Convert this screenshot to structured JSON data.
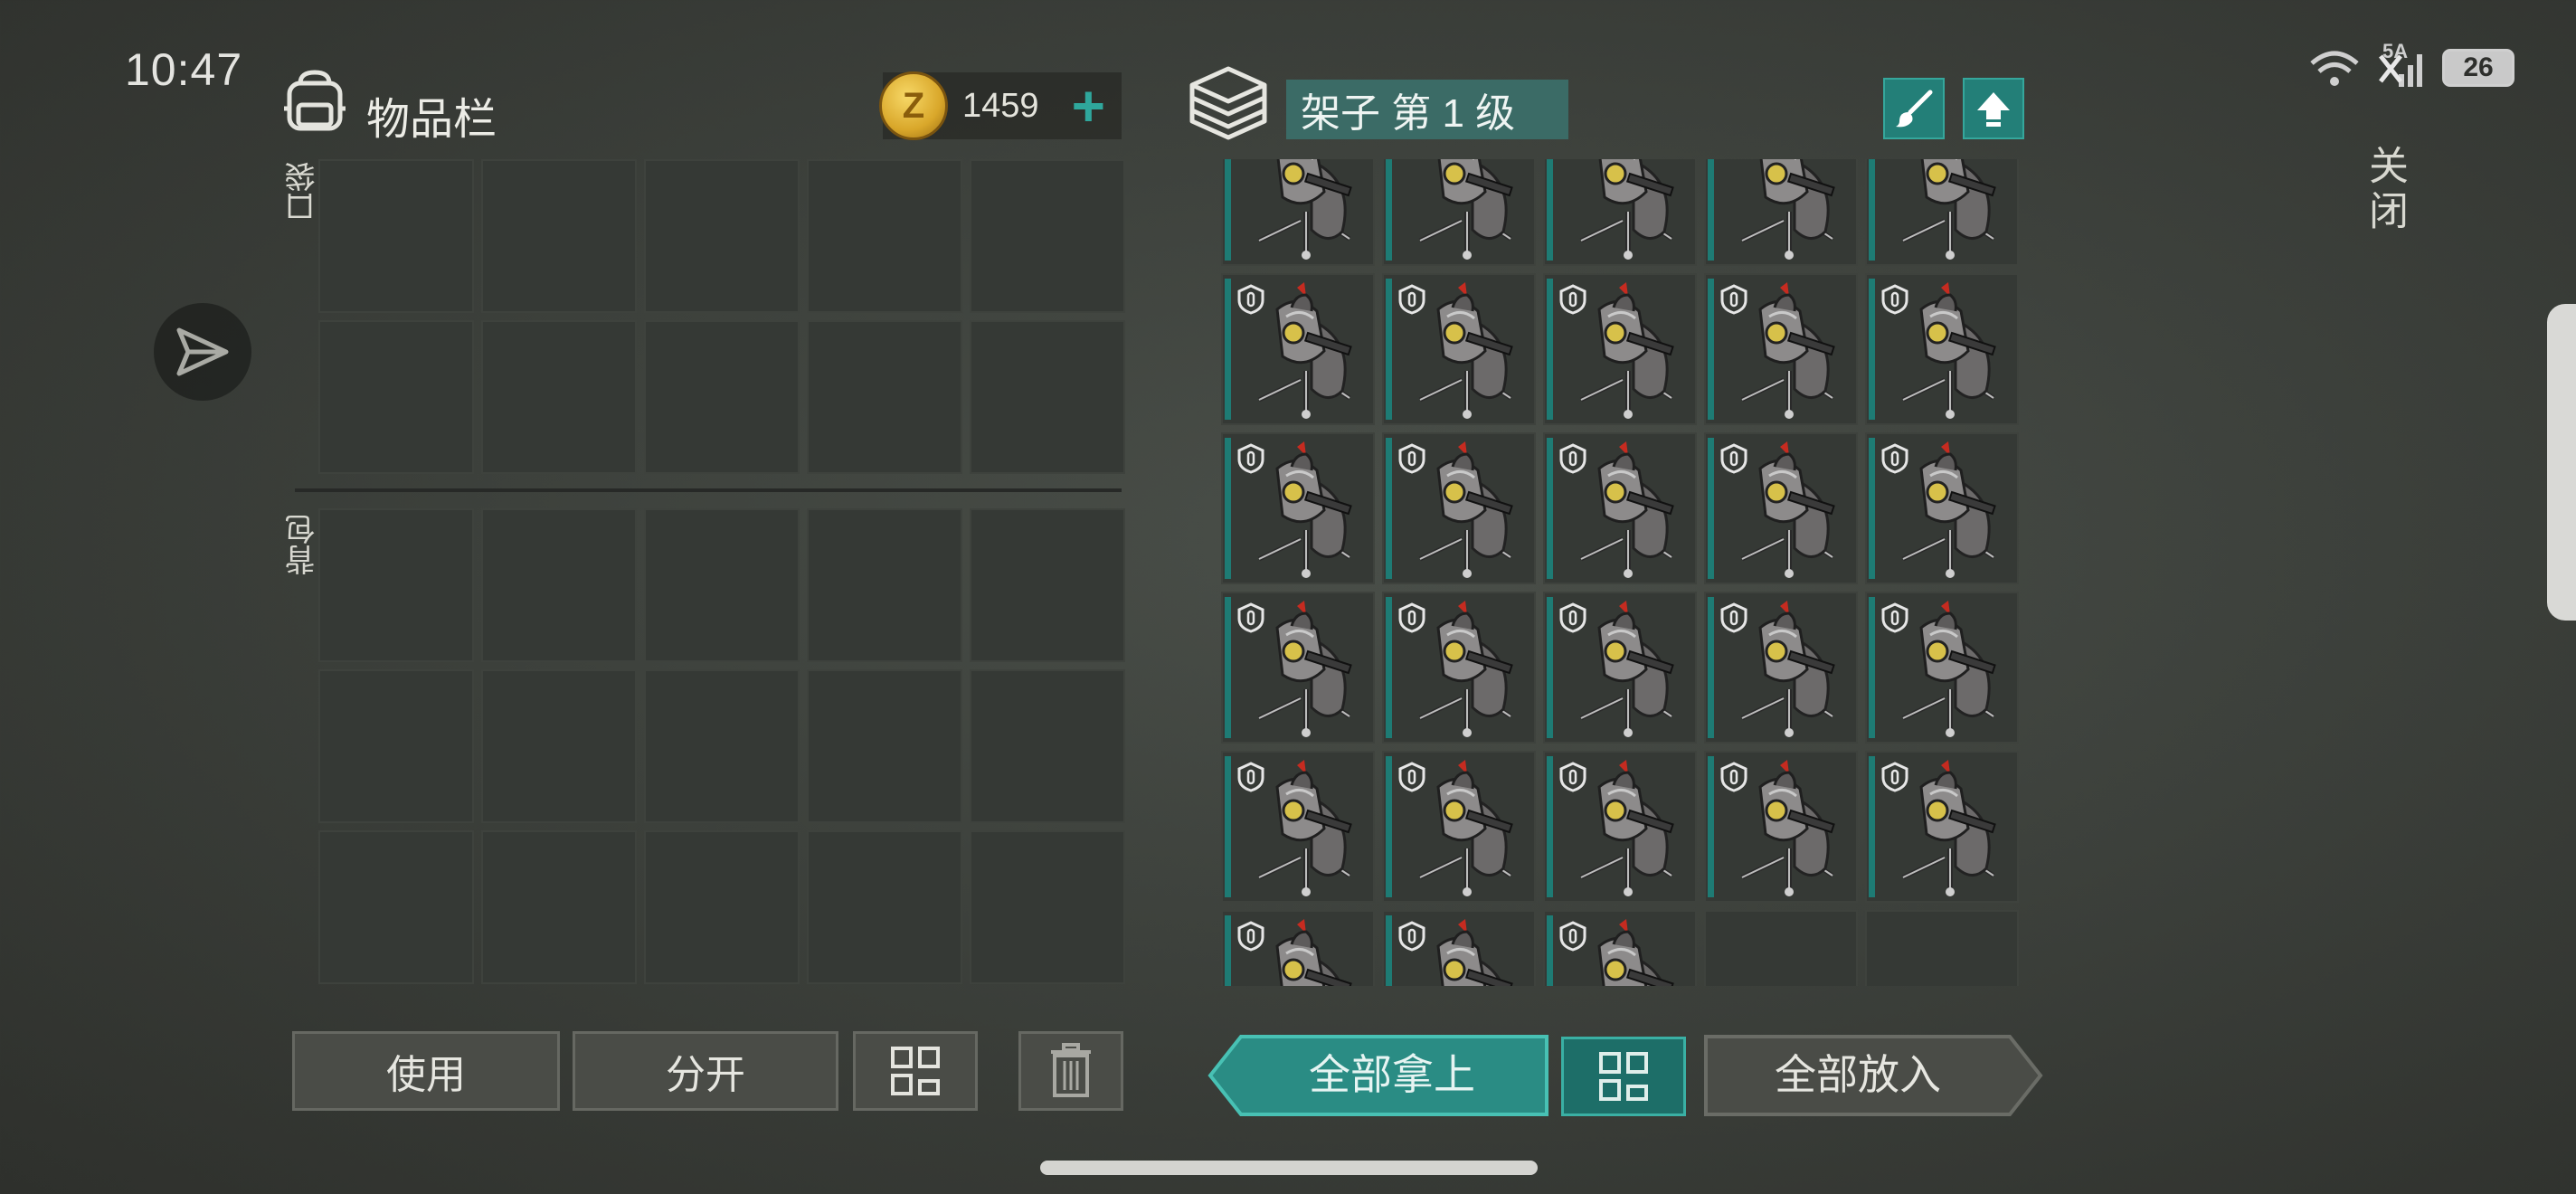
{
  "status_bar": {
    "time": "10:47",
    "network": "5A",
    "battery": "26"
  },
  "inventory": {
    "title": "物品栏",
    "currency": {
      "icon_letter": "Z",
      "amount": "1459",
      "add": "+"
    },
    "pocket_label": "口袋",
    "backpack_label": "背包",
    "pocket_rows": 2,
    "backpack_rows": 3,
    "columns": 5,
    "buttons": {
      "use": "使用",
      "split": "分开"
    }
  },
  "storage": {
    "title": "架子 第 1 级",
    "item_name": "turret",
    "filled_slots": 28,
    "total_slots": 30,
    "buttons": {
      "take_all": "全部拿上",
      "put_all": "全部放入"
    }
  },
  "close_label": "关闭",
  "colors": {
    "accent": "#237f78",
    "accent_light": "#35a79c",
    "cell": "#353935"
  }
}
